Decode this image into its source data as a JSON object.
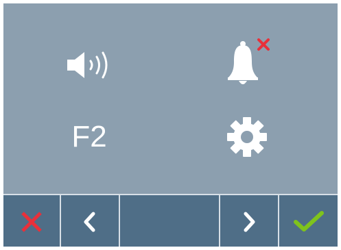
{
  "screen": {
    "background_color": "#8c9faf",
    "menu": [
      {
        "icon": "speaker-volume-icon"
      },
      {
        "icon": "bell-muted-icon",
        "status": "muted",
        "status_color": "#e8303a"
      },
      {
        "icon": "f2-function-key",
        "label": "F2"
      },
      {
        "icon": "gear-icon"
      }
    ]
  },
  "toolbar": {
    "background_color": "#4f6e87",
    "buttons": [
      {
        "icon": "close-icon",
        "color": "#e8303a"
      },
      {
        "icon": "chevron-left-icon",
        "color": "#ffffff"
      },
      {
        "icon": "blank"
      },
      {
        "icon": "chevron-right-icon",
        "color": "#ffffff"
      },
      {
        "icon": "checkmark-icon",
        "color": "#7fc31c"
      }
    ]
  }
}
